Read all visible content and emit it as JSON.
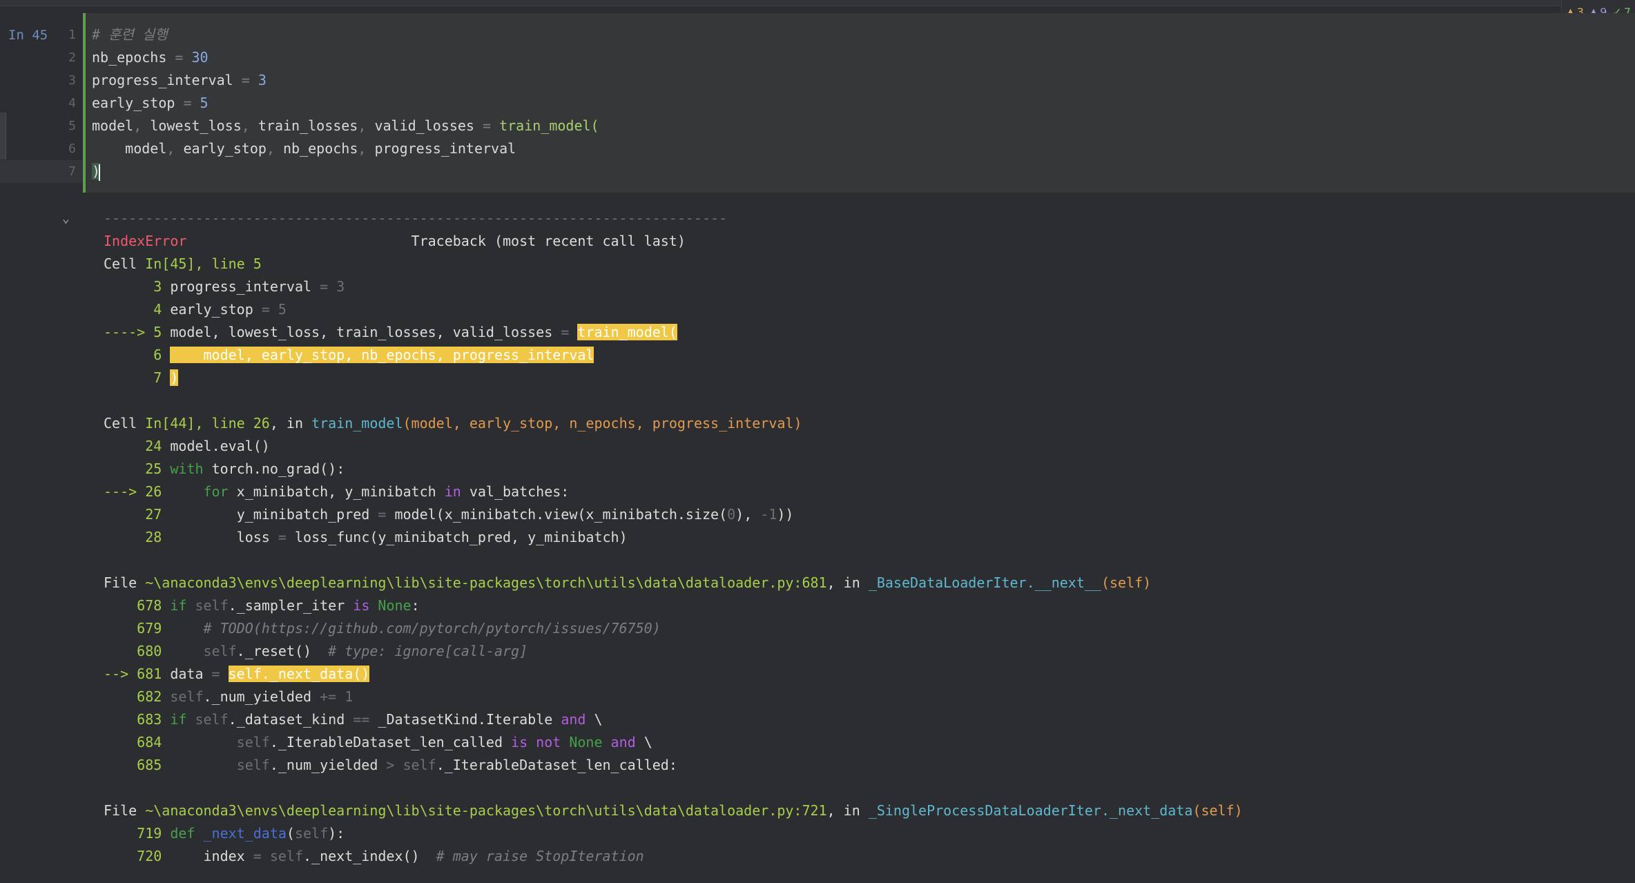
{
  "cell": {
    "exec_label": "In 45",
    "line_numbers": [
      "1",
      "2",
      "3",
      "4",
      "5",
      "6",
      "7"
    ],
    "comment": "# 훈련 실행",
    "l2": {
      "name": "nb_epochs",
      "eq": " = ",
      "val": "30"
    },
    "l3": {
      "name": "progress_interval",
      "eq": " = ",
      "val": "3"
    },
    "l4": {
      "name": "early_stop",
      "eq": " = ",
      "val": "5"
    },
    "l5": {
      "a": "model",
      "c1": ", ",
      "b": "lowest_loss",
      "c2": ", ",
      "c": "train_losses",
      "c3": ", ",
      "d": "valid_losses",
      "eq": " = ",
      "fn": "train_model("
    },
    "l6": {
      "indent": "    ",
      "a": "model",
      "c1": ", ",
      "b": "early_stop",
      "c2": ", ",
      "c": "nb_epochs",
      "c3": ", ",
      "d": "progress_interval"
    },
    "l7": ")"
  },
  "status": {
    "warnings": "3",
    "weak_warnings": "9",
    "ok": "7"
  },
  "traceback": {
    "dashes": "---------------------------------------------------------------------------",
    "error_name": "IndexError",
    "header": "Traceback (most recent call last)",
    "f1": {
      "prefix": "Cell ",
      "loc": "In[45], line 5",
      "l3_num": "3",
      "l3_name": "progress_interval",
      "l3_rest": " = 3",
      "l4_num": "4",
      "l4_name": "early_stop",
      "l4_rest": " = 5",
      "l5_arrow": "----> 5",
      "l5_code": "model, lowest_loss, train_losses, valid_losses",
      "l5_eq": " = ",
      "l5_call": "train_model(",
      "l6_num": "6",
      "l6_hl": "    model, early_stop, nb_epochs, progress_interval",
      "l7_num": "7",
      "l7_hl": ")"
    },
    "f2": {
      "prefix": "Cell ",
      "loc": "In[44], line 26",
      "in": ", in ",
      "fn": "train_model",
      "args": "(model, early_stop, n_epochs, progress_interval)",
      "l24_num": "24",
      "l24": "model.eval()",
      "l25_num": "25",
      "l25_kw": "with",
      "l25_rest": " torch.no_grad():",
      "l26_arrow": "---> 26",
      "l26_indent": "    ",
      "l26_kw": "for",
      "l26_a": " x_minibatch, y_minibatch ",
      "l26_in": "in",
      "l26_b": " val_batches:",
      "l27_num": "27",
      "l27_a": "        y_minibatch_pred",
      "l27_eq": " = ",
      "l27_b": "model(x_minibatch.view(x_minibatch.size(",
      "l27_z": "0",
      "l27_c": "), ",
      "l27_m": "-1",
      "l27_d": "))",
      "l28_num": "28",
      "l28_a": "        loss",
      "l28_eq": " = ",
      "l28_b": "loss_func(y_minibatch_pred, y_minibatch)"
    },
    "f3": {
      "prefix": "File ",
      "path": "~\\anaconda3\\envs\\deeplearning\\lib\\site-packages\\torch\\utils\\data\\dataloader.py:681",
      "in": ", in ",
      "fn": "_BaseDataLoaderIter.__next__",
      "args": "(self)",
      "l678_num": "678",
      "l678_if": "if",
      "l678_self": " self",
      "l678_a": "._sampler_iter ",
      "l678_is": "is",
      "l678_none": " None",
      "l678_b": ":",
      "l679_num": "679",
      "l679": "    # TODO(https://github.com/pytorch/pytorch/issues/76750)",
      "l680_num": "680",
      "l680_self": "    self",
      "l680_a": "._reset()  ",
      "l680_c": "# type: ignore[call-arg]",
      "l681_arrow": "--> 681",
      "l681_a": "data",
      "l681_eq": " = ",
      "l681_hl": "self._next_data()",
      "l682_num": "682",
      "l682_self": "self",
      "l682_a": "._num_yielded ",
      "l682_b": "+= 1",
      "l683_num": "683",
      "l683_if": "if",
      "l683_self": " self",
      "l683_a": "._dataset_kind ",
      "l683_eq": "==",
      "l683_b": " _DatasetKind.Iterable ",
      "l683_and": "and",
      "l683_c": " \\",
      "l684_num": "684",
      "l684_self": "        self",
      "l684_a": "._IterableDataset_len_called ",
      "l684_is": "is not",
      "l684_none": " None",
      "l684_and": " and",
      "l684_c": " \\",
      "l685_num": "685",
      "l685_self": "        self",
      "l685_a": "._num_yielded ",
      "l685_gt": ">",
      "l685_self2": " self",
      "l685_b": "._IterableDataset_len_called:"
    },
    "f4": {
      "prefix": "File ",
      "path": "~\\anaconda3\\envs\\deeplearning\\lib\\site-packages\\torch\\utils\\data\\dataloader.py:721",
      "in": ", in ",
      "fn": "_SingleProcessDataLoaderIter._next_data",
      "args": "(self)",
      "l719_num": "719",
      "l719_def": "def",
      "l719_fn": " _next_data",
      "l719_a": "(",
      "l719_self": "self",
      "l719_b": "):",
      "l720_num": "720",
      "l720_a": "    index",
      "l720_eq": " = ",
      "l720_self": "self",
      "l720_b": "._next_index()  ",
      "l720_c": "# may raise StopIteration"
    }
  }
}
